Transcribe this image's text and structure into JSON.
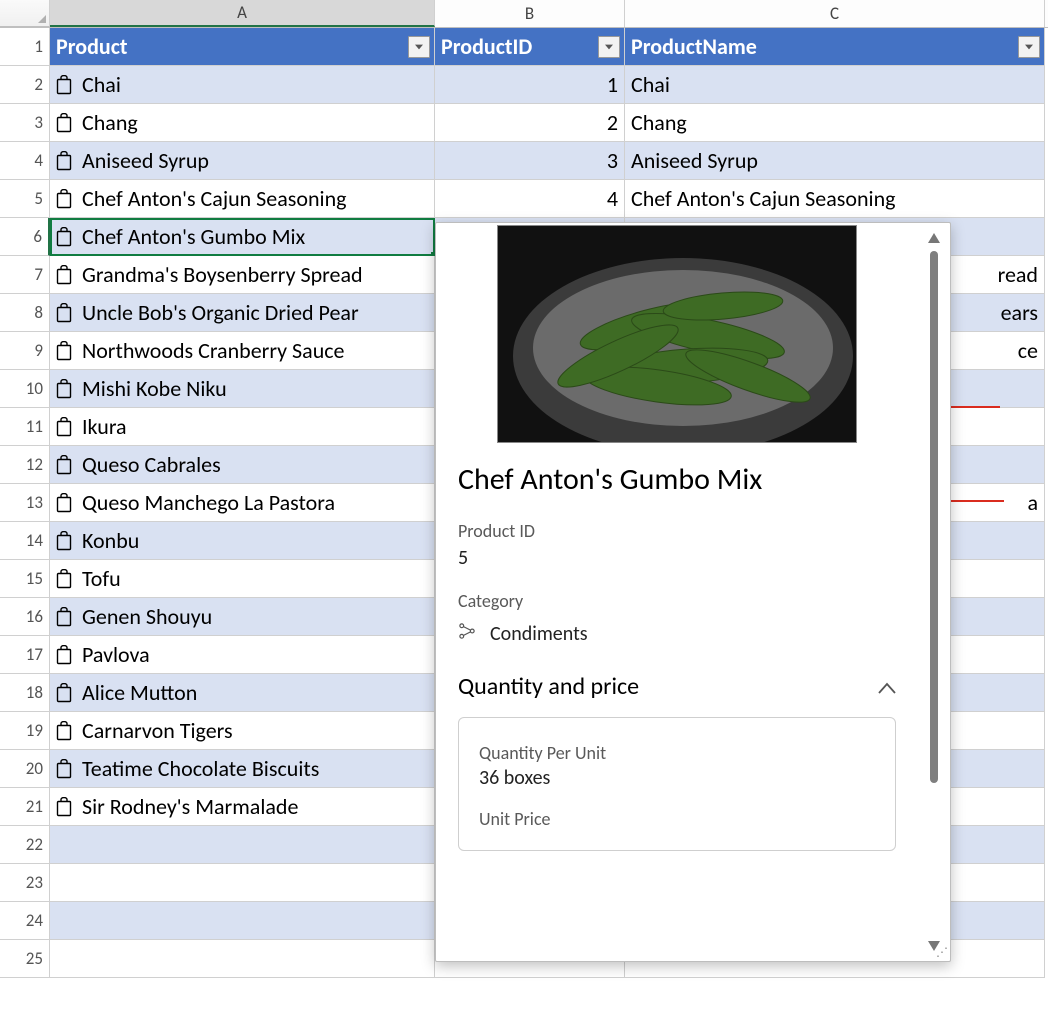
{
  "columns": {
    "A": "A",
    "B": "B",
    "C": "C"
  },
  "headers": {
    "A": "Product",
    "B": "ProductID",
    "C": "ProductName"
  },
  "rows": [
    {
      "product": "Chai",
      "id": "1",
      "name": "Chai"
    },
    {
      "product": "Chang",
      "id": "2",
      "name": "Chang"
    },
    {
      "product": "Aniseed Syrup",
      "id": "3",
      "name": "Aniseed Syrup"
    },
    {
      "product": "Chef Anton's Cajun Seasoning",
      "id": "4",
      "name": "Chef Anton's Cajun Seasoning"
    },
    {
      "product": "Chef Anton's Gumbo Mix",
      "id": "",
      "name": ""
    },
    {
      "product": "Grandma's Boysenberry Spread",
      "id": "",
      "name": "read",
      "suffix": true
    },
    {
      "product": "Uncle Bob's Organic Dried Pear",
      "id": "",
      "name": "ears",
      "suffix": true
    },
    {
      "product": "Northwoods Cranberry Sauce",
      "id": "",
      "name": "ce",
      "suffix": true
    },
    {
      "product": "Mishi Kobe Niku",
      "id": "",
      "name": ""
    },
    {
      "product": "Ikura",
      "id": "",
      "name": ""
    },
    {
      "product": "Queso Cabrales",
      "id": "",
      "name": ""
    },
    {
      "product": "Queso Manchego La Pastora",
      "id": "",
      "name": "a",
      "suffix": true
    },
    {
      "product": "Konbu",
      "id": "",
      "name": ""
    },
    {
      "product": "Tofu",
      "id": "",
      "name": ""
    },
    {
      "product": "Genen Shouyu",
      "id": "",
      "name": ""
    },
    {
      "product": "Pavlova",
      "id": "",
      "name": ""
    },
    {
      "product": "Alice Mutton",
      "id": "",
      "name": ""
    },
    {
      "product": "Carnarvon Tigers",
      "id": "",
      "name": ""
    },
    {
      "product": "Teatime Chocolate Biscuits",
      "id": "",
      "name": ""
    },
    {
      "product": "Sir Rodney's Marmalade",
      "id": "",
      "name": ""
    }
  ],
  "selected_row": 6,
  "card": {
    "title": "Chef Anton's Gumbo Mix",
    "product_id_label": "Product ID",
    "product_id_value": "5",
    "category_label": "Category",
    "category_value": "Condiments",
    "section_title": "Quantity and price",
    "qpu_label": "Quantity Per Unit",
    "qpu_value": "36 boxes",
    "unit_price_label": "Unit Price"
  },
  "row_numbers": [
    "1",
    "2",
    "3",
    "4",
    "5",
    "6",
    "7",
    "8",
    "9",
    "10",
    "11",
    "12",
    "13",
    "14",
    "15",
    "16",
    "17",
    "18",
    "19",
    "20",
    "21",
    "22",
    "23",
    "24",
    "25"
  ]
}
